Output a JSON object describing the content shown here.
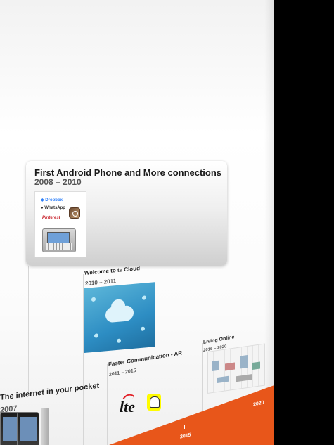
{
  "slide": {
    "android_card": {
      "title": "First Android Phone and More connections",
      "years": "2008 – 2010",
      "apps": {
        "dropbox": "◆ Dropbox",
        "whatsapp": "● WhatsApp",
        "pinterest": "Pinterest"
      }
    },
    "cloud": {
      "title": "Welcome to te Cloud",
      "years": "2010 – 2011"
    },
    "faster": {
      "title": "Faster Communication - AR",
      "years": "2011 – 2015"
    },
    "living": {
      "title": "Living Online",
      "years": "2016 – 2020"
    },
    "pocket": {
      "title": "The internet in your pocket",
      "years": "2007"
    },
    "lte_text": "lte",
    "timeline_years": [
      "2015",
      "2020"
    ]
  },
  "colors": {
    "accent_orange": "#e8561a",
    "background": "#000000"
  }
}
